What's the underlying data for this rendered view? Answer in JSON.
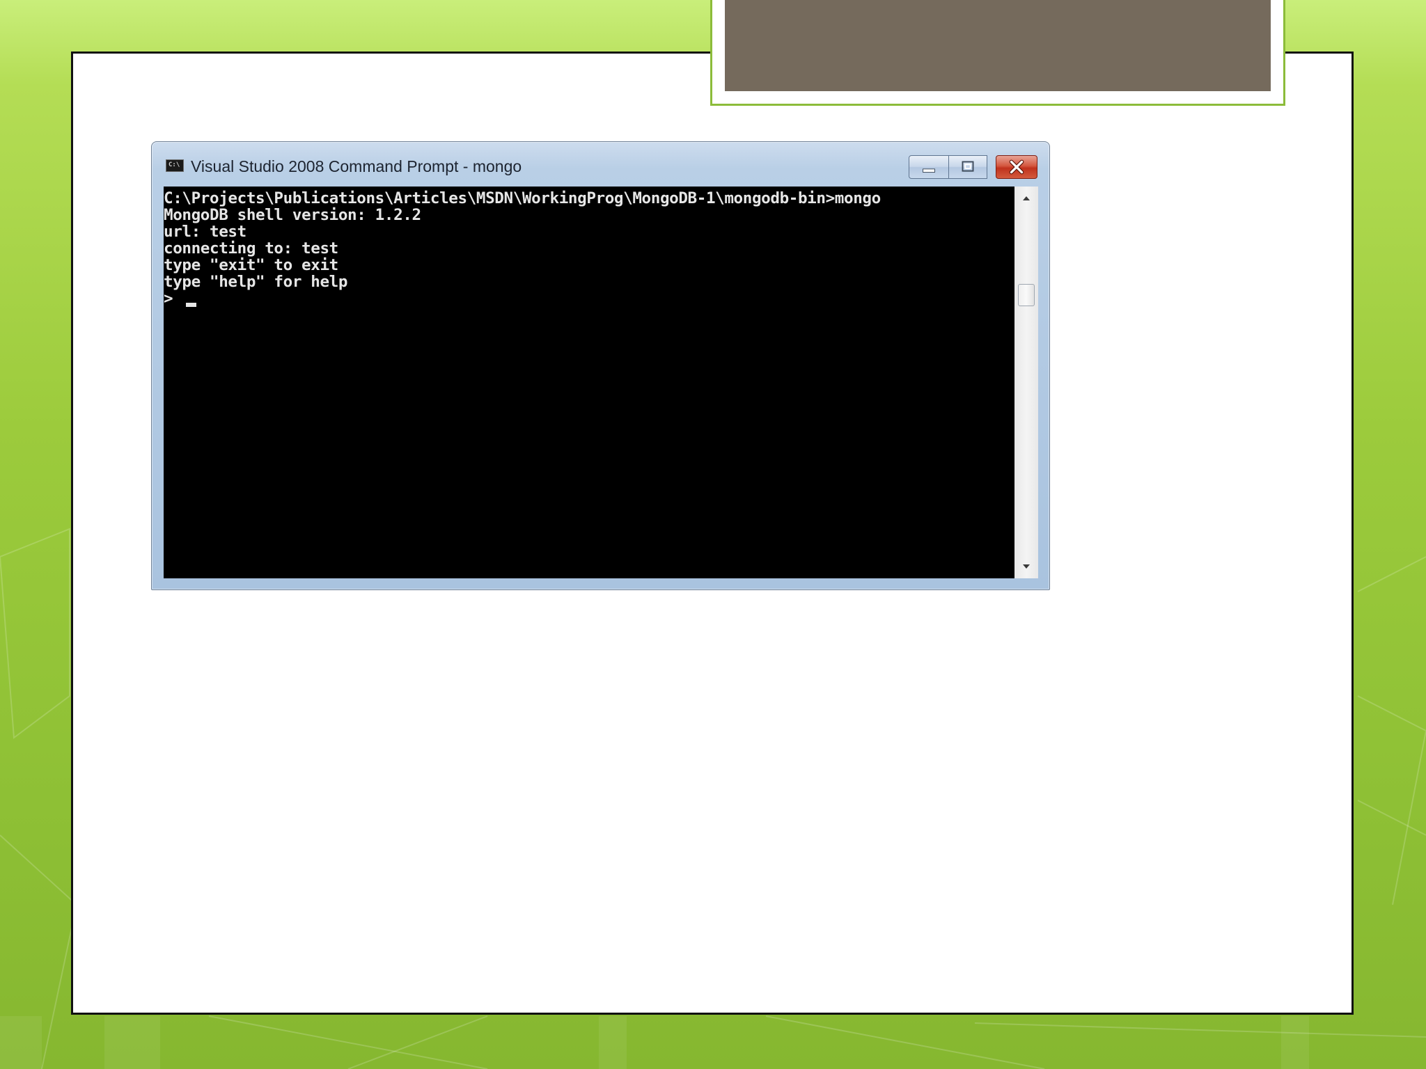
{
  "window": {
    "title": "Visual Studio 2008 Command Prompt - mongo",
    "icon": "cmd-icon",
    "icon_text": "C:\\",
    "controls": [
      "minimize-icon",
      "maximize-icon",
      "close-icon"
    ]
  },
  "console": {
    "lines": [
      "C:\\Projects\\Publications\\Articles\\MSDN\\WorkingProg\\MongoDB-1\\mongodb-bin>mongo",
      "MongoDB shell version: 1.2.2",
      "url: test",
      "connecting to: test",
      "type \"exit\" to exit",
      "type \"help\" for help",
      "> "
    ]
  },
  "colors": {
    "slide_background": "#9fcc3a",
    "title_box_fill": "#756a5c",
    "console_background": "#000000",
    "console_text": "#e6e6e6",
    "close_button": "#c0321d"
  }
}
